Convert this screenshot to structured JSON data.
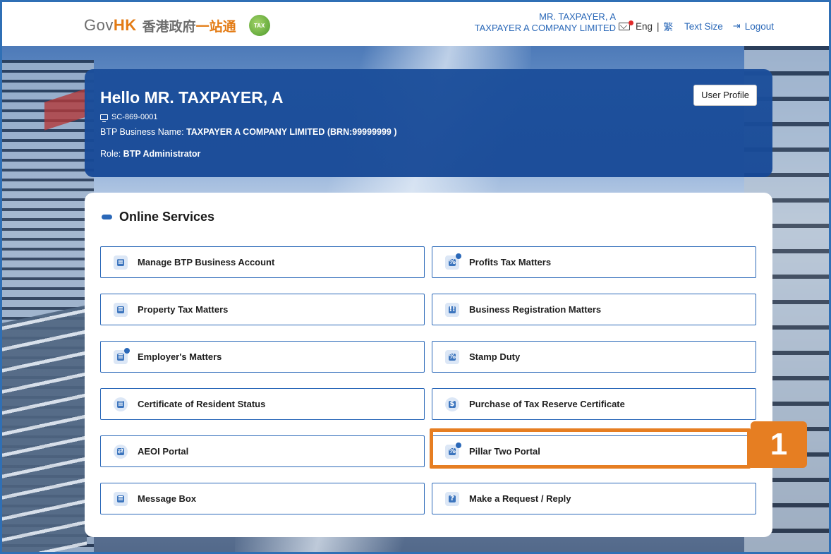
{
  "header": {
    "logo_gov": "GovHK",
    "logo_cn_part1": "香港政府",
    "logo_cn_part2": "一站通",
    "badge_text": "TAX",
    "user_name": "MR. TAXPAYER, A",
    "company_name": "TAXPAYER A COMPANY LIMITED",
    "lang_eng": "Eng",
    "lang_sep": "|",
    "lang_trad": "繁",
    "text_size": "Text Size",
    "logout": "Logout"
  },
  "profile": {
    "greeting": "Hello MR. TAXPAYER, A",
    "account_id": "SC-869-0001",
    "business_label": "BTP Business Name:",
    "business_value": "TAXPAYER A COMPANY LIMITED (BRN:99999999 )",
    "role_label": "Role:",
    "role_value": "BTP Administrator",
    "profile_button": "User Profile"
  },
  "services": {
    "title": "Online Services",
    "items": [
      {
        "label": "Manage BTP Business Account",
        "icon": "id-card-icon"
      },
      {
        "label": "Profits Tax Matters",
        "icon": "percent-doc-icon"
      },
      {
        "label": "Property Tax Matters",
        "icon": "building-doc-icon"
      },
      {
        "label": "Business Registration Matters",
        "icon": "registration-icon"
      },
      {
        "label": "Employer's Matters",
        "icon": "employer-doc-icon"
      },
      {
        "label": "Stamp Duty",
        "icon": "stamp-percent-icon"
      },
      {
        "label": "Certificate of Resident Status",
        "icon": "certificate-icon"
      },
      {
        "label": "Purchase of Tax Reserve Certificate",
        "icon": "dollar-icon"
      },
      {
        "label": "AEOI Portal",
        "icon": "exchange-icon"
      },
      {
        "label": "Pillar Two Portal",
        "icon": "globe-percent-icon"
      },
      {
        "label": "Message Box",
        "icon": "message-icon"
      },
      {
        "label": "Make a Request / Reply",
        "icon": "question-icon"
      }
    ]
  },
  "annotation": {
    "number": "1",
    "color": "#e67e22"
  },
  "colors": {
    "primary": "#2a68b8",
    "profile_bg": "#1c4f9b",
    "accent": "#e37b14"
  }
}
